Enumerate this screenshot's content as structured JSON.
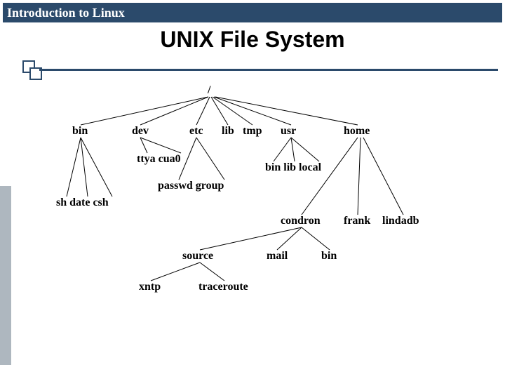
{
  "header": {
    "course_title": "Introduction to Linux"
  },
  "slide": {
    "title": "UNIX File System"
  },
  "tree": {
    "root": "/",
    "level1": {
      "bin": "bin",
      "dev": "dev",
      "etc": "etc",
      "lib": "lib",
      "tmp": "tmp",
      "usr": "usr",
      "home": "home"
    },
    "bin_children": "sh date csh",
    "dev_children": "ttya cua0",
    "etc_children": "passwd  group",
    "usr_children": "bin lib local",
    "home_children": {
      "condron": "condron",
      "frank": "frank",
      "lindadb": "lindadb"
    },
    "condron_children": {
      "source": "source",
      "mail": "mail",
      "bin": "bin"
    },
    "condron_bin_children": {
      "xntp": "xntp",
      "traceroute": "traceroute"
    }
  }
}
